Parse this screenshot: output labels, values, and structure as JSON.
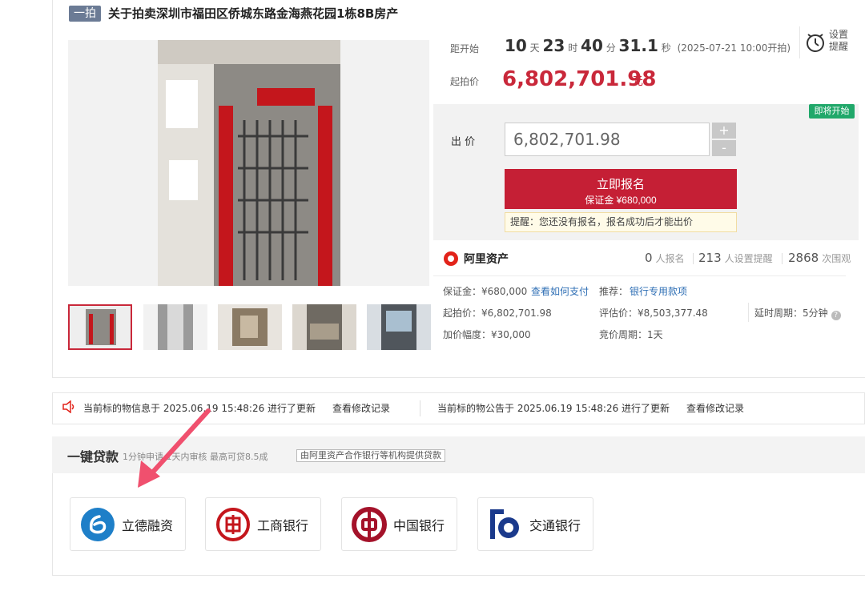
{
  "header": {
    "tag": "一拍",
    "title": "关于拍卖深圳市福田区侨城东路金海燕花园1栋8B房产"
  },
  "countdown": {
    "label": "距开始",
    "days": "10",
    "days_unit": "天",
    "hours": "23",
    "hours_unit": "时",
    "minutes": "40",
    "minutes_unit": "分",
    "seconds": "31.1",
    "seconds_unit": "秒",
    "start_note": "(2025-07-21 10:00开拍)"
  },
  "remind": {
    "label": "设置提醒"
  },
  "start_price": {
    "label": "起拍价",
    "value": "6,802,701.98",
    "unit": "元"
  },
  "bid": {
    "status_badge": "即将开始",
    "label": "出 价",
    "input_value": "6,802,701.98",
    "plus": "+",
    "minus": "-",
    "signup_label": "立即报名",
    "deposit_label": "保证金 ¥680,000",
    "tip": "提醒：您还没有报名，报名成功后才能出价"
  },
  "stats": {
    "platform": "阿里资产",
    "signups": "0",
    "signups_label": "人报名",
    "reminders": "213",
    "reminders_label": "人设置提醒",
    "views": "2868",
    "views_label": "次围观"
  },
  "details": {
    "deposit": "保证金：¥680,000",
    "how_to_pay": "查看如何支付",
    "recommend_label": "推荐：",
    "recommend_link": "银行专用款项",
    "start_price": "起拍价：¥6,802,701.98",
    "appraisal": "评估价：¥8,503,377.48",
    "delay_period": "延时周期：5分钟",
    "increment": "加价幅度：¥30,000",
    "bid_period": "竞价周期：1天"
  },
  "updates": {
    "info_text": "当前标的物信息于 2025.06.19 15:48:26 进行了更新",
    "info_link": "查看修改记录",
    "notice_text": "当前标的物公告于 2025.06.19 15:48:26 进行了更新",
    "notice_link": "查看修改记录"
  },
  "loan": {
    "title": "一键贷款",
    "subtitle": "1分钟申请 1天内审核 最高可贷8.5成",
    "tag": "由阿里资产合作银行等机构提供贷款",
    "banks": [
      {
        "name": "立德融资"
      },
      {
        "name": "工商银行"
      },
      {
        "name": "中国银行"
      },
      {
        "name": "交通银行"
      }
    ]
  },
  "colors": {
    "accent": "#c51f35",
    "link": "#2f6fb5",
    "badge": "#20a86a",
    "annotation_arrow": "#f0506e"
  }
}
